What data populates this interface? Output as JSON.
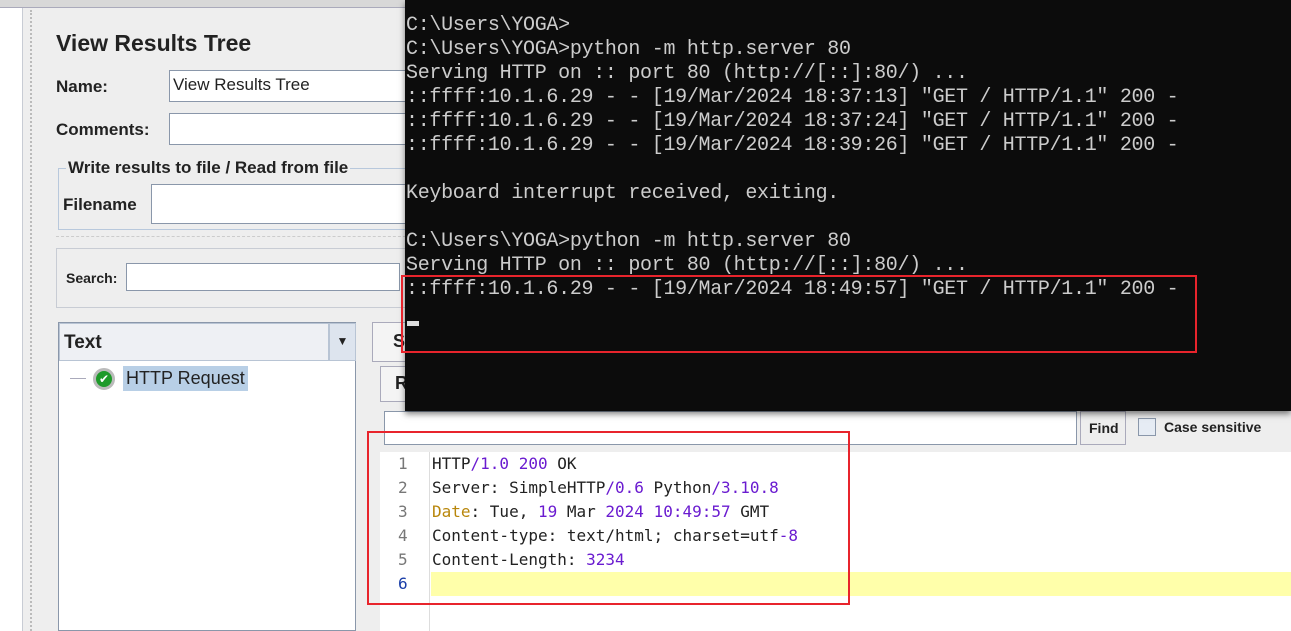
{
  "panel": {
    "title": "View Results Tree",
    "name_label": "Name:",
    "name_value": "View Results Tree",
    "comments_label": "Comments:",
    "comments_value": "",
    "file_group": "Write results to file / Read from file",
    "filename_label": "Filename",
    "search_label": "Search:",
    "renderer": "Text",
    "tree_item": "HTTP Request",
    "tab_s": "S",
    "tab_r": "R",
    "find_button": "Find",
    "case_sensitive": "Case sensitive"
  },
  "terminal": {
    "lines": [
      "C:\\Users\\YOGA>",
      "C:\\Users\\YOGA>python -m http.server 80",
      "Serving HTTP on :: port 80 (http://[::]:80/) ...",
      "::ffff:10.1.6.29 - - [19/Mar/2024 18:37:13] \"GET / HTTP/1.1\" 200 -",
      "::ffff:10.1.6.29 - - [19/Mar/2024 18:37:24] \"GET / HTTP/1.1\" 200 -",
      "::ffff:10.1.6.29 - - [19/Mar/2024 18:39:26] \"GET / HTTP/1.1\" 200 -",
      "",
      "Keyboard interrupt received, exiting.",
      "",
      "C:\\Users\\YOGA>python -m http.server 80",
      "Serving HTTP on :: port 80 (http://[::]:80/) ...",
      "::ffff:10.1.6.29 - - [19/Mar/2024 18:49:57] \"GET / HTTP/1.1\" 200 -"
    ]
  },
  "response": {
    "lines": [
      {
        "n": "1",
        "t": [
          [
            "HTTP",
            "#222"
          ],
          [
            "/1.0 200",
            "#6a1bd0"
          ],
          [
            " OK",
            "#222"
          ]
        ]
      },
      {
        "n": "2",
        "t": [
          [
            "Server: SimpleHTTP",
            "#222"
          ],
          [
            "/0.6",
            "#6a1bd0"
          ],
          [
            " Python",
            "#222"
          ],
          [
            "/3.10.8",
            "#6a1bd0"
          ]
        ]
      },
      {
        "n": "3",
        "t": [
          [
            "Date",
            "#b8860b"
          ],
          [
            ": Tue, ",
            "#222"
          ],
          [
            "19",
            "#6a1bd0"
          ],
          [
            " Mar ",
            "#222"
          ],
          [
            "2024 10:49:57",
            "#6a1bd0"
          ],
          [
            " GMT",
            "#222"
          ]
        ]
      },
      {
        "n": "4",
        "t": [
          [
            "Content-type: text/html; charset=utf",
            "#222"
          ],
          [
            "-8",
            "#6a1bd0"
          ]
        ]
      },
      {
        "n": "5",
        "t": [
          [
            "Content-Length: ",
            "#222"
          ],
          [
            "3234",
            "#6a1bd0"
          ]
        ]
      },
      {
        "n": "6",
        "t": []
      }
    ]
  },
  "colors": {
    "highlight_box": "#e8242c",
    "terminal_bg": "#0c0c0c",
    "current_line": "#ffffaa"
  }
}
